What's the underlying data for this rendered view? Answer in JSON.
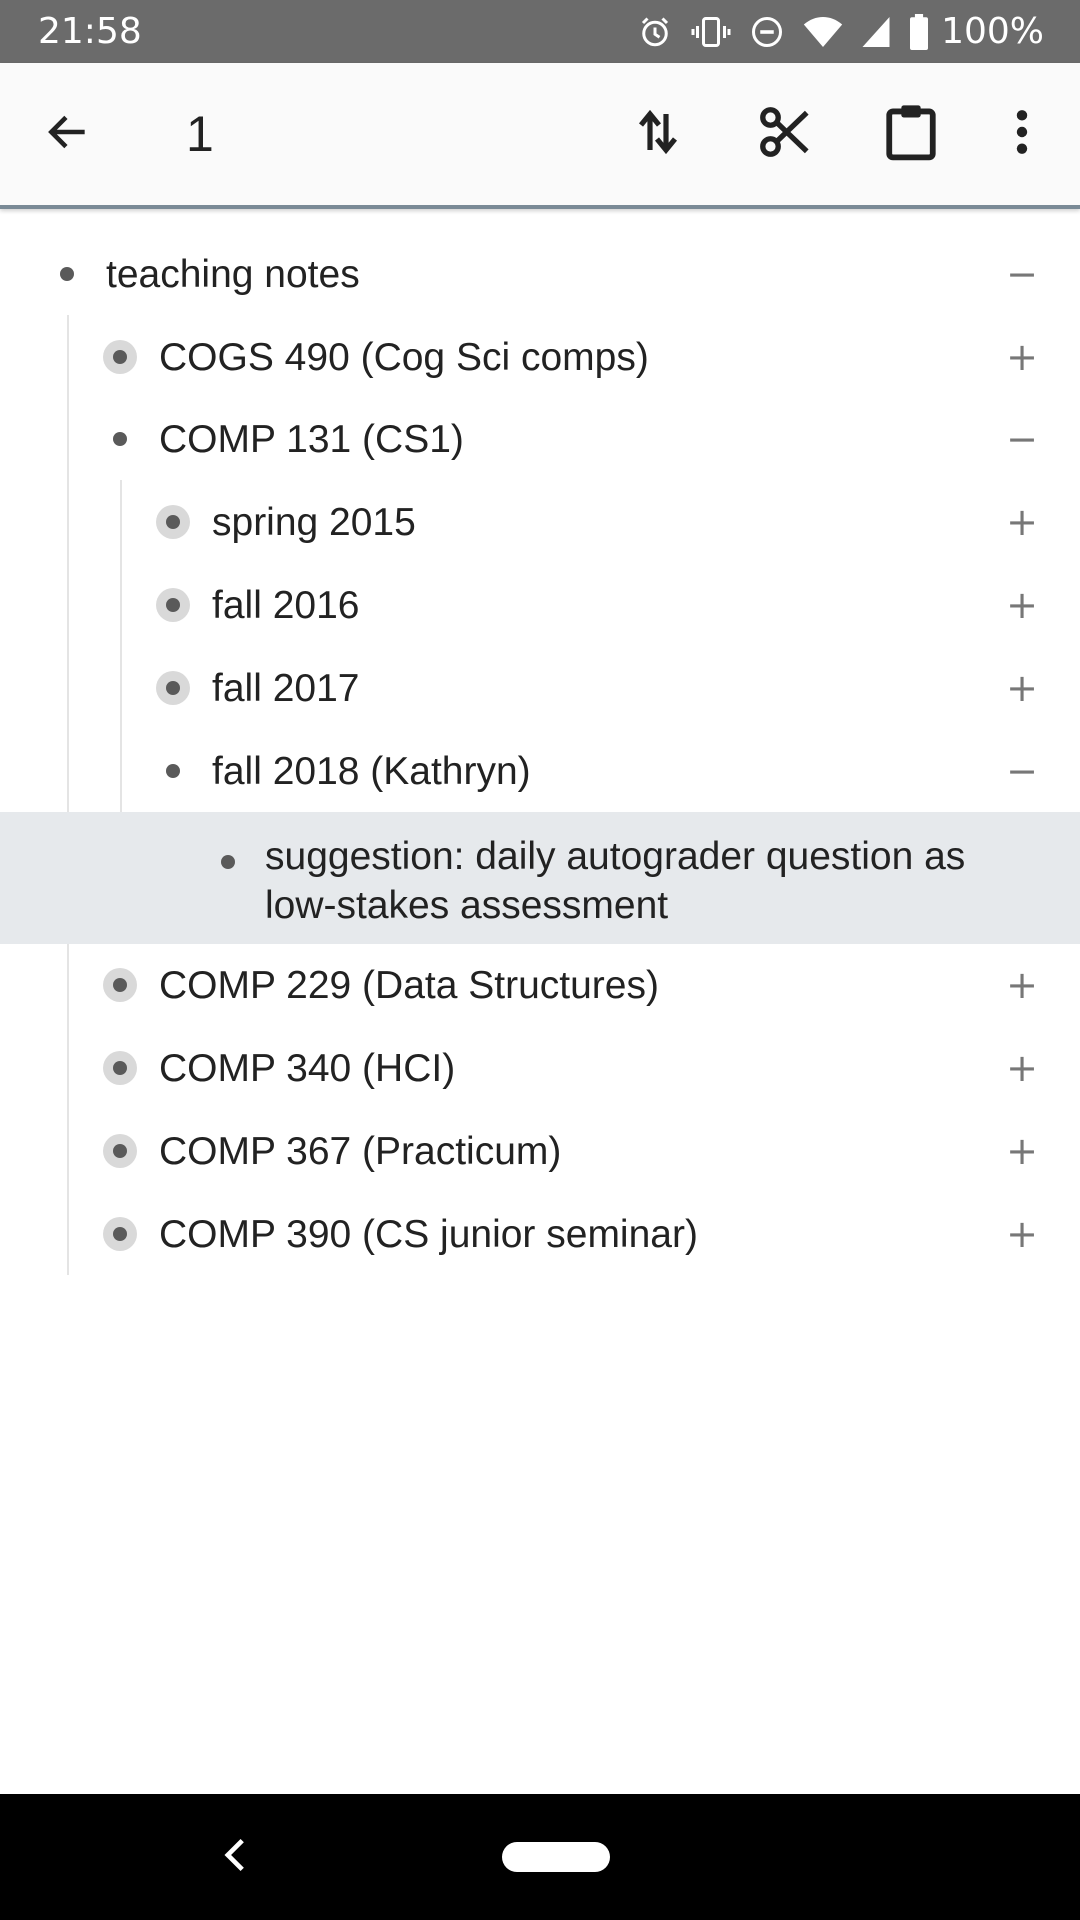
{
  "status_bar": {
    "time": "21:58",
    "battery": "100%",
    "icons": [
      "alarm-icon",
      "vibrate-icon",
      "do-not-disturb-icon",
      "wifi-icon",
      "signal-icon",
      "battery-icon"
    ]
  },
  "toolbar": {
    "title": "1",
    "icons": [
      "back-arrow-icon",
      "sort-icon",
      "cut-icon",
      "paste-icon",
      "more-vert-icon"
    ]
  },
  "outline": {
    "rows": [
      {
        "text": "teaching notes",
        "level": 0,
        "toggle": "−",
        "collapsed": false
      },
      {
        "text": "COGS 490 (Cog Sci comps)",
        "level": 1,
        "toggle": "+",
        "collapsed": true
      },
      {
        "text": "COMP 131 (CS1)",
        "level": 1,
        "toggle": "−",
        "collapsed": false
      },
      {
        "text": "spring 2015",
        "level": 2,
        "toggle": "+",
        "collapsed": true
      },
      {
        "text": "fall 2016",
        "level": 2,
        "toggle": "+",
        "collapsed": true
      },
      {
        "text": "fall 2017",
        "level": 2,
        "toggle": "+",
        "collapsed": true
      },
      {
        "text": "fall 2018 (Kathryn)",
        "level": 2,
        "toggle": "−",
        "collapsed": false
      },
      {
        "text": "COMP 229 (Data Structures)",
        "level": 1,
        "toggle": "+",
        "collapsed": true
      },
      {
        "text": "COMP 340 (HCI)",
        "level": 1,
        "toggle": "+",
        "collapsed": true
      },
      {
        "text": "COMP 367 (Practicum)",
        "level": 1,
        "toggle": "+",
        "collapsed": true
      },
      {
        "text": "COMP 390 (CS junior seminar)",
        "level": 1,
        "toggle": "+",
        "collapsed": true
      }
    ],
    "selected": {
      "text": "suggestion: daily autograder question as low-stakes assessment",
      "level": 3
    }
  },
  "colors": {
    "status_bar": "#6b6b6b",
    "toolbar_bg": "#fafafa",
    "selected_bg": "#e6e9ec",
    "nav_bar": "#000000"
  }
}
